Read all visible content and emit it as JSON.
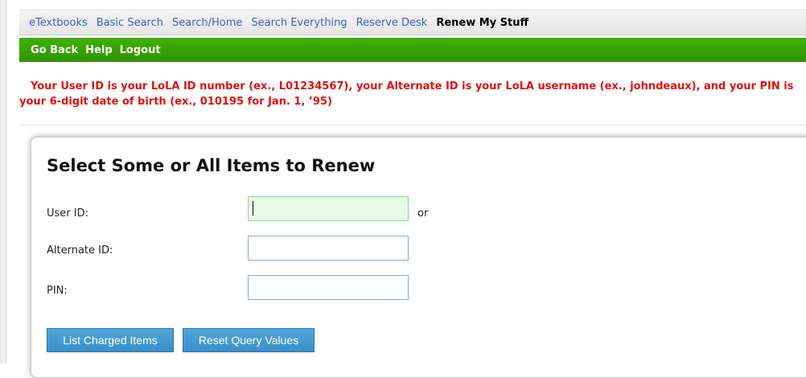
{
  "top_nav": {
    "items": [
      {
        "label": "eTextbooks"
      },
      {
        "label": "Basic Search"
      },
      {
        "label": "Search/Home"
      },
      {
        "label": "Search Everything"
      },
      {
        "label": "Reserve Desk"
      },
      {
        "label": "Renew My Stuff",
        "active": true
      }
    ]
  },
  "green_bar": {
    "go_back": "Go Back",
    "help": "Help",
    "logout": "Logout"
  },
  "notice": {
    "text": "Your User ID is your LoLA ID number (ex., L01234567), your Alternate ID is your LoLA username (ex., johndeaux), and your PIN is your 6-digit date of birth (ex., 010195 for Jan. 1, ’95)"
  },
  "form": {
    "title": "Select Some or All Items to Renew",
    "user_id_label": "User ID:",
    "user_id_value": "",
    "or_text": "or",
    "alternate_id_label": "Alternate ID:",
    "alternate_id_value": "",
    "pin_label": "PIN:",
    "pin_value": "",
    "list_button": "List Charged Items",
    "reset_button": "Reset Query Values"
  },
  "colors": {
    "nav_link": "#3a5fcd",
    "green_bar": "#38a300",
    "notice": "#e01010",
    "button": "#4599d3",
    "focused_input_bg": "#e6f9e6"
  }
}
